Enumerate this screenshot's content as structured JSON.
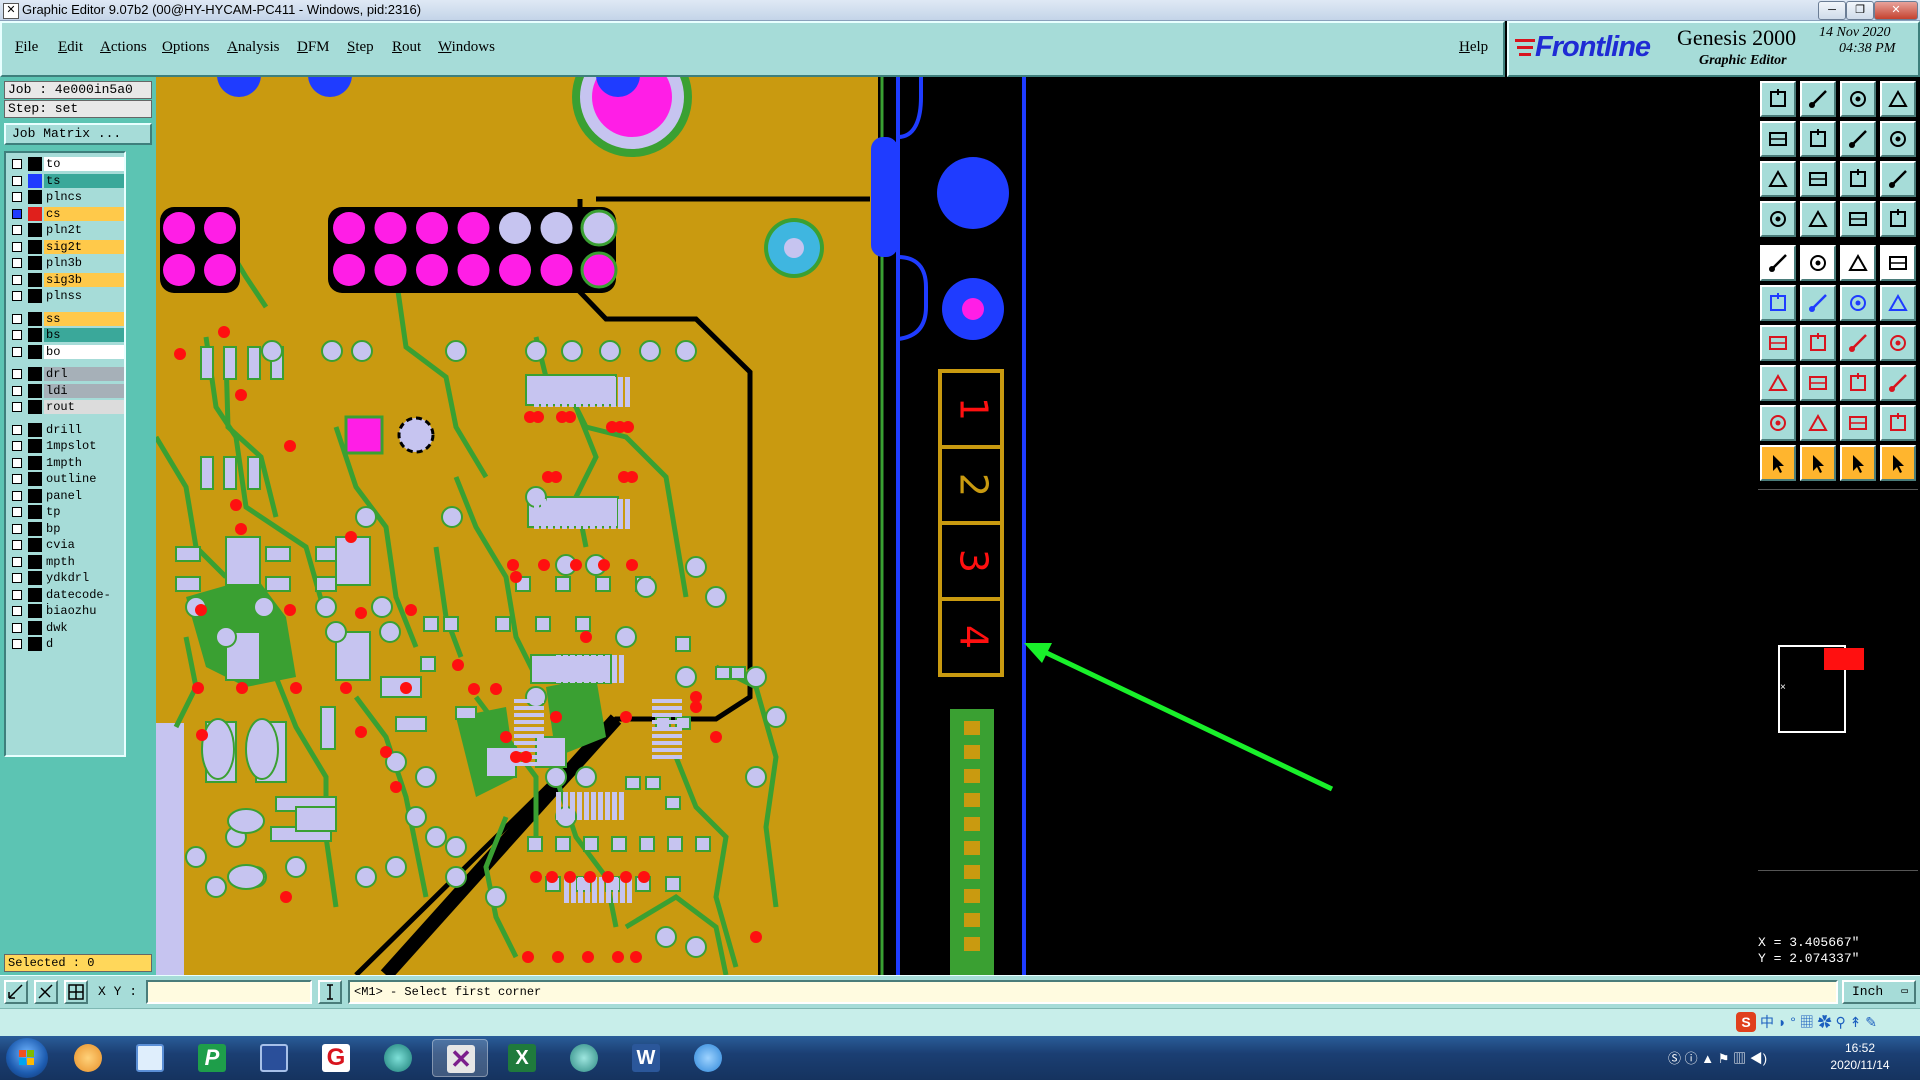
{
  "window": {
    "title": "Graphic Editor 9.07b2 (00@HY-HYCAM-PC411 - Windows, pid:2316)",
    "minimize_glyph": "─",
    "maximize_glyph": "❐",
    "close_glyph": "✕"
  },
  "menu": {
    "items": [
      "File",
      "Edit",
      "Actions",
      "Options",
      "Analysis",
      "DFM",
      "Step",
      "Rout",
      "Windows"
    ],
    "help": "Help"
  },
  "brand": {
    "logo": "Frontline",
    "product": "Genesis 2000",
    "subtitle": "Graphic Editor",
    "date": "14 Nov 2020",
    "time": "04:38 PM"
  },
  "job": {
    "job_line": "Job : 4e000in5a0",
    "step_line": "Step: set",
    "matrix_button": "Job Matrix ..."
  },
  "layers": [
    {
      "name": "to",
      "color": "#ffffff",
      "swatch": "#000000",
      "checked": false
    },
    {
      "name": "ts",
      "color": "#3aa89a",
      "swatch": "#1f3cff",
      "checked": false
    },
    {
      "name": "plncs",
      "color": "#a6dcd8",
      "swatch": "#000000",
      "checked": false
    },
    {
      "name": "cs",
      "color": "#ffc94a",
      "swatch": "#e0201c",
      "checked": true
    },
    {
      "name": "pln2t",
      "color": "#a6dcd8",
      "swatch": "#000000",
      "checked": false
    },
    {
      "name": "sig2t",
      "color": "#ffc94a",
      "swatch": "#000000",
      "checked": false
    },
    {
      "name": "pln3b",
      "color": "#a6dcd8",
      "swatch": "#000000",
      "checked": false
    },
    {
      "name": "sig3b",
      "color": "#ffc94a",
      "swatch": "#000000",
      "checked": false
    },
    {
      "name": "plnss",
      "color": "#a6dcd8",
      "swatch": "#000000",
      "checked": false
    },
    {
      "name": "ss",
      "color": "#ffc94a",
      "swatch": "#000000",
      "checked": false
    },
    {
      "name": "bs",
      "color": "#3aa89a",
      "swatch": "#000000",
      "checked": false
    },
    {
      "name": "bo",
      "color": "#ffffff",
      "swatch": "#000000",
      "checked": false
    },
    {
      "name": "drl",
      "color": "#a6b0b8",
      "swatch": "#000000",
      "checked": false
    },
    {
      "name": "ldi",
      "color": "#a6b0b8",
      "swatch": "#000000",
      "checked": false
    },
    {
      "name": "rout",
      "color": "#dcdcdc",
      "swatch": "#000000",
      "checked": false
    },
    {
      "name": "drill",
      "color": "#a6dcd8",
      "swatch": "#000000",
      "checked": false
    },
    {
      "name": "1mpslot",
      "color": "#a6dcd8",
      "swatch": "#000000",
      "checked": false
    },
    {
      "name": "1mpth",
      "color": "#a6dcd8",
      "swatch": "#000000",
      "checked": false
    },
    {
      "name": "outline",
      "color": "#a6dcd8",
      "swatch": "#000000",
      "checked": false
    },
    {
      "name": "panel",
      "color": "#a6dcd8",
      "swatch": "#000000",
      "checked": false
    },
    {
      "name": "tp",
      "color": "#a6dcd8",
      "swatch": "#000000",
      "checked": false
    },
    {
      "name": "bp",
      "color": "#a6dcd8",
      "swatch": "#000000",
      "checked": false
    },
    {
      "name": "cvia",
      "color": "#a6dcd8",
      "swatch": "#000000",
      "checked": false
    },
    {
      "name": "mpth",
      "color": "#a6dcd8",
      "swatch": "#000000",
      "checked": false
    },
    {
      "name": "ydkdrl",
      "color": "#a6dcd8",
      "swatch": "#000000",
      "checked": false
    },
    {
      "name": "datecode-bo",
      "color": "#a6dcd8",
      "swatch": "#000000",
      "checked": false
    },
    {
      "name": "biaozhu",
      "color": "#a6dcd8",
      "swatch": "#000000",
      "checked": false
    },
    {
      "name": "dwk",
      "color": "#a6dcd8",
      "swatch": "#000000",
      "checked": false
    },
    {
      "name": "d",
      "color": "#a6dcd8",
      "swatch": "#000000",
      "checked": false
    }
  ],
  "selected_text": "Selected : 0",
  "canvas": {
    "board_numbers": [
      "1",
      "2",
      "3",
      "4"
    ],
    "colors": {
      "copper": "#c99a10",
      "trace": "#3aa032",
      "pad": "#c6c4f0",
      "magenta": "#ff1ee6",
      "red": "#ff1010",
      "blue": "#1f3cff",
      "outline": "#000000",
      "arrow": "#19f02a"
    }
  },
  "status": {
    "xy_label": "X Y :",
    "xy_value": "",
    "prompt": "<M1> - Select first corner",
    "units": "Inch"
  },
  "coords": {
    "x": "X = 3.405667\"",
    "y": "Y = 2.074337\""
  },
  "taskbar": {
    "time": "16:52",
    "date": "2020/11/14"
  }
}
